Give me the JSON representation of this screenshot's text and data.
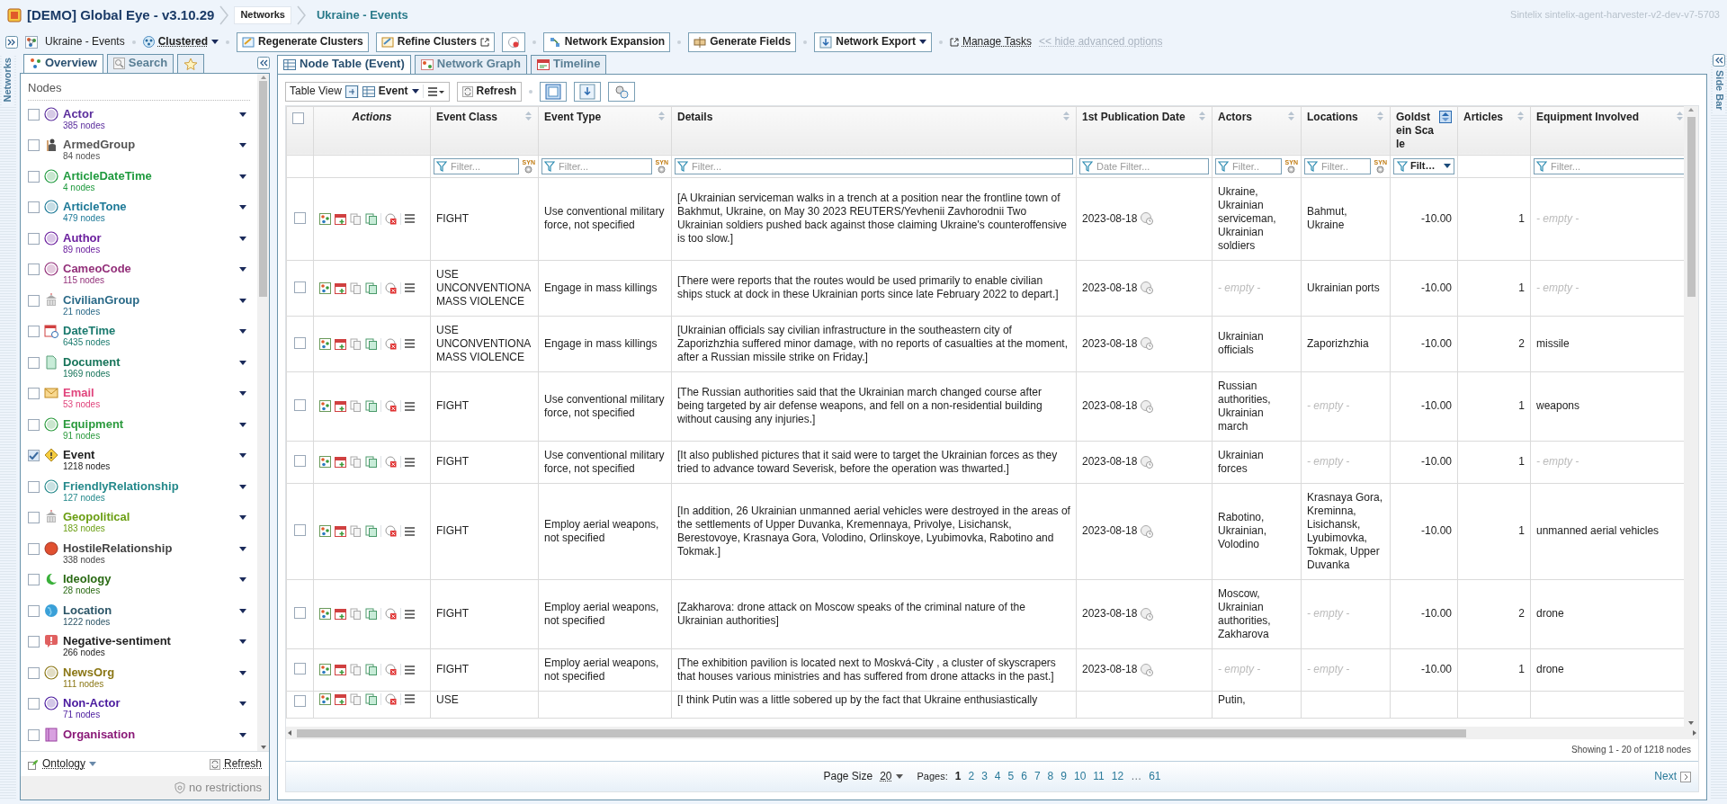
{
  "app": {
    "title": "[DEMO] Global Eye - v3.10.29",
    "breadcrumbs": [
      {
        "label": "Networks",
        "current": false
      },
      {
        "label": "Ukraine - Events",
        "current": true
      }
    ],
    "instance": "Sintelix sintelix-agent-harvester-v2-dev-v7-5703"
  },
  "toolbar": {
    "network": "Ukraine - Events",
    "layout": "Clustered",
    "actions": [
      {
        "label": "Regenerate Clusters",
        "kind": "button",
        "separator_before": true
      },
      {
        "label": "Refine Clusters",
        "kind": "external",
        "separator_before": false
      },
      {
        "kind": "icon",
        "separator_before": false
      },
      {
        "label": "Network Expansion",
        "kind": "button",
        "separator_before": true
      },
      {
        "label": "Generate Fields",
        "kind": "button",
        "separator_before": true
      },
      {
        "label": "Network Export",
        "kind": "dropdown",
        "separator_before": true
      }
    ],
    "manage_tasks": "Manage Tasks",
    "hide_options": "<< hide advanced options"
  },
  "strips": {
    "left": "Networks",
    "right": "Side Bar"
  },
  "sidebar": {
    "tabs": [
      {
        "label": "Overview",
        "kind": "text",
        "selected": true
      },
      {
        "label": "Search",
        "kind": "text",
        "selected": false
      },
      {
        "kind": "favorites",
        "selected": false
      }
    ],
    "heading": "Nodes",
    "nodes": [
      {
        "name": "Actor",
        "count": "385 nodes",
        "color": "#5a2d9c",
        "kind": "badge",
        "checked": false
      },
      {
        "name": "ArmedGroup",
        "count": "84 nodes",
        "color": "#555555",
        "kind": "figure",
        "checked": false
      },
      {
        "name": "ArticleDateTime",
        "count": "4 nodes",
        "color": "#1f9a3e",
        "kind": "badge",
        "checked": false
      },
      {
        "name": "ArticleTone",
        "count": "479 nodes",
        "color": "#1b7896",
        "kind": "badge",
        "checked": false
      },
      {
        "name": "Author",
        "count": "89 nodes",
        "color": "#6b1f9e",
        "kind": "badge",
        "checked": false
      },
      {
        "name": "CameoCode",
        "count": "115 nodes",
        "color": "#93307a",
        "kind": "badge",
        "checked": false
      },
      {
        "name": "CivilianGroup",
        "count": "21 nodes",
        "color": "#2b6a88",
        "kind": "building",
        "checked": false
      },
      {
        "name": "DateTime",
        "count": "6435 nodes",
        "color": "#1a7a6e",
        "kind": "calendar",
        "checked": false
      },
      {
        "name": "Document",
        "count": "1969 nodes",
        "color": "#17745a",
        "kind": "document",
        "checked": false
      },
      {
        "name": "Email",
        "count": "53 nodes",
        "color": "#e0447c",
        "kind": "email",
        "checked": false
      },
      {
        "name": "Equipment",
        "count": "91 nodes",
        "color": "#2a9a3c",
        "kind": "badge",
        "checked": false
      },
      {
        "name": "Event",
        "count": "1218 nodes",
        "color": "#222222",
        "kind": "warning",
        "checked": true
      },
      {
        "name": "FriendlyRelationship",
        "count": "127 nodes",
        "color": "#23888a",
        "kind": "badge",
        "checked": false
      },
      {
        "name": "Geopolitical",
        "count": "183 nodes",
        "color": "#6a9e12",
        "kind": "building",
        "checked": false
      },
      {
        "name": "HostileRelationship",
        "count": "338 nodes",
        "color": "#444444",
        "kind": "hostile",
        "checked": false
      },
      {
        "name": "Ideology",
        "count": "28 nodes",
        "color": "#2a6a14",
        "kind": "crescent",
        "checked": false
      },
      {
        "name": "Location",
        "count": "1222 nodes",
        "color": "#2b5466",
        "kind": "globe",
        "checked": false
      },
      {
        "name": "Negative-sentiment",
        "count": "266 nodes",
        "color": "#222222",
        "kind": "alert",
        "checked": false
      },
      {
        "name": "NewsOrg",
        "count": "111 nodes",
        "color": "#8a7614",
        "kind": "badge",
        "checked": false
      },
      {
        "name": "Non-Actor",
        "count": "71 nodes",
        "color": "#4a1a9e",
        "kind": "badge",
        "checked": false
      },
      {
        "name": "Organisation",
        "color": "#8a1a78",
        "kind": "books",
        "checked": false
      }
    ],
    "ontology": "Ontology",
    "refresh": "Refresh",
    "restrictions": "no restrictions"
  },
  "content": {
    "tabs": [
      {
        "label": "Node Table (Event)",
        "selected": true
      },
      {
        "label": "Network Graph",
        "selected": false
      },
      {
        "label": "Timeline",
        "selected": false
      }
    ],
    "view": {
      "label": "Table View",
      "node_type": "Event",
      "refresh": "Refresh"
    },
    "table": {
      "all_selected": false,
      "columns": [
        {
          "label": "Actions",
          "kind": "actions"
        },
        {
          "label": "Event Class",
          "kind": "text",
          "filter": {
            "placeholder": "Filter..."
          },
          "syn": "SYN",
          "sorted": false
        },
        {
          "label": "Event Type",
          "kind": "text",
          "filter": {
            "placeholder": "Filter..."
          },
          "syn": "SYN",
          "sorted": false
        },
        {
          "label": "Details",
          "kind": "text",
          "filter": {
            "placeholder": "Filter..."
          },
          "sorted": false
        },
        {
          "label": "1st Publication Date",
          "kind": "date",
          "filter": {
            "placeholder": "Date Filter..."
          },
          "sorted": false
        },
        {
          "label": "Actors",
          "kind": "text",
          "filter": {
            "placeholder": "Filter.."
          },
          "syn": "SYN",
          "sorted": false
        },
        {
          "label": "Locations",
          "kind": "text",
          "filter": {
            "placeholder": "Filter.."
          },
          "syn": "SYN",
          "sorted": false
        },
        {
          "label": "Goldstein Scale",
          "kind": "number",
          "filter": {
            "kind": "select",
            "value": "Filt…"
          },
          "sorted": true
        },
        {
          "label": "Articles",
          "kind": "number",
          "sorted": false
        },
        {
          "label": "Equipment Involved",
          "kind": "text",
          "filter": {
            "placeholder": "Filter..."
          },
          "sorted": false
        }
      ],
      "rows": [
        {
          "selected": false,
          "cells": [
            null,
            {
              "text": "FIGHT"
            },
            {
              "text": "Use conventional military force, not specified"
            },
            {
              "text": "[A Ukrainian serviceman walks in a trench at a position near the frontline town of Bakhmut, Ukraine, on May 30 2023 REUTERS/Yevhenii Zavhorodnii Two Ukrainian soldiers pushed back against those claiming Ukraine's counteroffensive is too slow.]"
            },
            {
              "text": "2023-08-18"
            },
            {
              "text": "Ukraine, Ukrainian serviceman, Ukrainian soldiers"
            },
            {
              "text": "Bahmut, Ukraine"
            },
            {
              "text": "-10.00"
            },
            {
              "text": "1"
            },
            {
              "text": "- empty -",
              "empty": true
            }
          ]
        },
        {
          "selected": false,
          "cells": [
            null,
            {
              "text": "USE UNCONVENTIONA MASS VIOLENCE"
            },
            {
              "text": "Engage in mass killings"
            },
            {
              "text": "[There were reports that the routes would be used primarily to enable civilian ships stuck at dock in these Ukrainian ports since late February 2022 to depart.]"
            },
            {
              "text": "2023-08-18"
            },
            {
              "text": "- empty -",
              "empty": true
            },
            {
              "text": "Ukrainian ports"
            },
            {
              "text": "-10.00"
            },
            {
              "text": "1"
            },
            {
              "text": "- empty -",
              "empty": true
            }
          ]
        },
        {
          "selected": false,
          "cells": [
            null,
            {
              "text": "USE UNCONVENTIONA MASS VIOLENCE"
            },
            {
              "text": "Engage in mass killings"
            },
            {
              "text": "[Ukrainian officials say civilian infrastructure in the southeastern city of Zaporizhzhia suffered minor damage, with no reports of casualties at the moment, after a Russian missile strike on Friday.]"
            },
            {
              "text": "2023-08-18"
            },
            {
              "text": "Ukrainian officials"
            },
            {
              "text": "Zaporizhzhia"
            },
            {
              "text": "-10.00"
            },
            {
              "text": "2"
            },
            {
              "text": "missile"
            }
          ]
        },
        {
          "selected": false,
          "cells": [
            null,
            {
              "text": "FIGHT"
            },
            {
              "text": "Use conventional military force, not specified"
            },
            {
              "text": "[The Russian authorities said that the Ukrainian march changed course after being targeted by air defense weapons, and fell on a non-residential building without causing any injuries.]"
            },
            {
              "text": "2023-08-18"
            },
            {
              "text": "Russian authorities, Ukrainian march"
            },
            {
              "text": "- empty -",
              "empty": true
            },
            {
              "text": "-10.00"
            },
            {
              "text": "1"
            },
            {
              "text": "weapons"
            }
          ]
        },
        {
          "selected": false,
          "cells": [
            null,
            {
              "text": "FIGHT"
            },
            {
              "text": "Use conventional military force, not specified"
            },
            {
              "text": "[It also published pictures that it said were to target the Ukrainian forces as they tried to advance toward Severisk, before the operation was thwarted.]"
            },
            {
              "text": "2023-08-18"
            },
            {
              "text": "Ukrainian forces"
            },
            {
              "text": "- empty -",
              "empty": true
            },
            {
              "text": "-10.00"
            },
            {
              "text": "1"
            },
            {
              "text": "- empty -",
              "empty": true
            }
          ]
        },
        {
          "selected": false,
          "cells": [
            null,
            {
              "text": "FIGHT"
            },
            {
              "text": "Employ aerial weapons, not specified"
            },
            {
              "text": "[In addition, 26 Ukrainian unmanned aerial vehicles were destroyed in the areas of the settlements of Upper Duvanka, Kremennaya, Privolye, Lisichansk, Berestovoye, Krasnaya Gora, Volodino, Orlinskoye, Lyubimovka, Rabotino and Tokmak.]"
            },
            {
              "text": "2023-08-18"
            },
            {
              "text": "Rabotino, Ukrainian, Volodino"
            },
            {
              "text": "Krasnaya Gora, Kreminna, Lisichansk, Lyubimovka, Tokmak, Upper Duvanka"
            },
            {
              "text": "-10.00"
            },
            {
              "text": "1"
            },
            {
              "text": "unmanned aerial vehicles"
            }
          ]
        },
        {
          "selected": false,
          "cells": [
            null,
            {
              "text": "FIGHT"
            },
            {
              "text": "Employ aerial weapons, not specified"
            },
            {
              "text": "[Zakharova: drone attack on Moscow speaks of the criminal nature of the Ukrainian authorities]"
            },
            {
              "text": "2023-08-18"
            },
            {
              "text": "Moscow, Ukrainian authorities, Zakharova"
            },
            {
              "text": "- empty -",
              "empty": true
            },
            {
              "text": "-10.00"
            },
            {
              "text": "2"
            },
            {
              "text": "drone"
            }
          ]
        },
        {
          "selected": false,
          "cells": [
            null,
            {
              "text": "FIGHT"
            },
            {
              "text": "Employ aerial weapons, not specified"
            },
            {
              "text": "[The exhibition pavilion is located next to Moskvá-City , a cluster of skyscrapers that houses various ministries and has suffered from drone attacks in the past.]"
            },
            {
              "text": "2023-08-18"
            },
            {
              "text": "- empty -",
              "empty": true
            },
            {
              "text": "- empty -",
              "empty": true
            },
            {
              "text": "-10.00"
            },
            {
              "text": "1"
            },
            {
              "text": "drone"
            }
          ]
        },
        {
          "selected": false,
          "partial": true,
          "cells": [
            null,
            {
              "text": "USE"
            },
            null,
            {
              "text": "[I think Putin was a little sobered up by the fact that Ukraine enthusiastically"
            },
            null,
            {
              "text": "Putin,"
            }
          ]
        }
      ]
    },
    "summary": "Showing 1 - 20 of 1218 nodes",
    "pager": {
      "page_size_label": "Page Size",
      "page_size": "20",
      "pages_label": "Pages:",
      "pages": [
        {
          "label": "1",
          "selected": true
        },
        {
          "label": "2",
          "selected": false
        },
        {
          "label": "3",
          "selected": false
        },
        {
          "label": "4",
          "selected": false
        },
        {
          "label": "5",
          "selected": false
        },
        {
          "label": "6",
          "selected": false
        },
        {
          "label": "7",
          "selected": false
        },
        {
          "label": "8",
          "selected": false
        },
        {
          "label": "9",
          "selected": false
        },
        {
          "label": "10",
          "selected": false
        },
        {
          "label": "11",
          "selected": false
        },
        {
          "label": "12",
          "selected": false
        },
        {
          "label": "…",
          "kind": "ellipsis"
        },
        {
          "label": "61",
          "selected": false
        }
      ],
      "next": "Next"
    }
  }
}
